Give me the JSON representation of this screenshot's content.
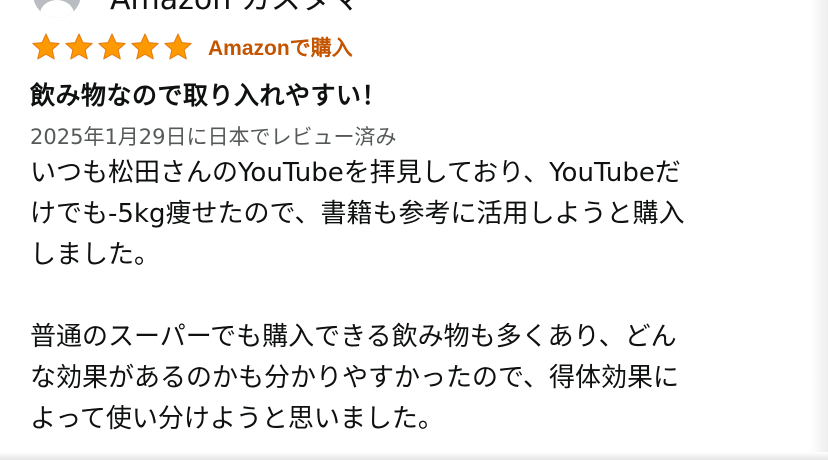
{
  "reviewer": {
    "name": "Amazon カスタマー"
  },
  "review": {
    "rating": 5,
    "rating_max": 5,
    "star_color": "#ff9900",
    "verified_label": "Amazonで購入",
    "verified_color": "#c45500",
    "title": "飲み物なので取り入れやすい！",
    "date": "2025年1月29日に日本でレビュー済み",
    "body_lines": [
      "いつも松田さんのYouTubeを拝見しており、YouTubeだ",
      "けでも-5kg痩せたので、書籍も参考に活用しようと購入",
      "しました。",
      "",
      "普通のスーパーでも購入できる飲み物も多くあり、どん",
      "な効果があるのかも分かりやすかったので、得体効果に",
      "よって使い分けようと思いました。"
    ]
  }
}
